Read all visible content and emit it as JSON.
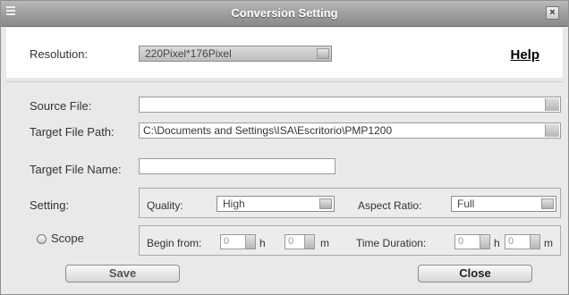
{
  "window": {
    "title": "Conversion Setting"
  },
  "resolution": {
    "label": "Resolution:",
    "value": "220Pixel*176Pixel"
  },
  "help_label": "Help",
  "source_file": {
    "label": "Source File:",
    "value": ""
  },
  "target_path": {
    "label": "Target File Path:",
    "value": "C:\\Documents and Settings\\ISA\\Escritorio\\PMP1200"
  },
  "target_name": {
    "label": "Target File Name:",
    "value": ""
  },
  "setting": {
    "label": "Setting:",
    "quality_label": "Quality:",
    "quality_value": "High",
    "aspect_label": "Aspect Ratio:",
    "aspect_value": "Full"
  },
  "scope": {
    "label": "Scope",
    "begin_label": "Begin from:",
    "begin_h": "0",
    "h_unit": "h",
    "begin_m": "0",
    "m_unit": "m",
    "duration_label": "Time Duration:",
    "dur_h": "0",
    "dur_m": "0"
  },
  "buttons": {
    "save": "Save",
    "close": "Close"
  }
}
